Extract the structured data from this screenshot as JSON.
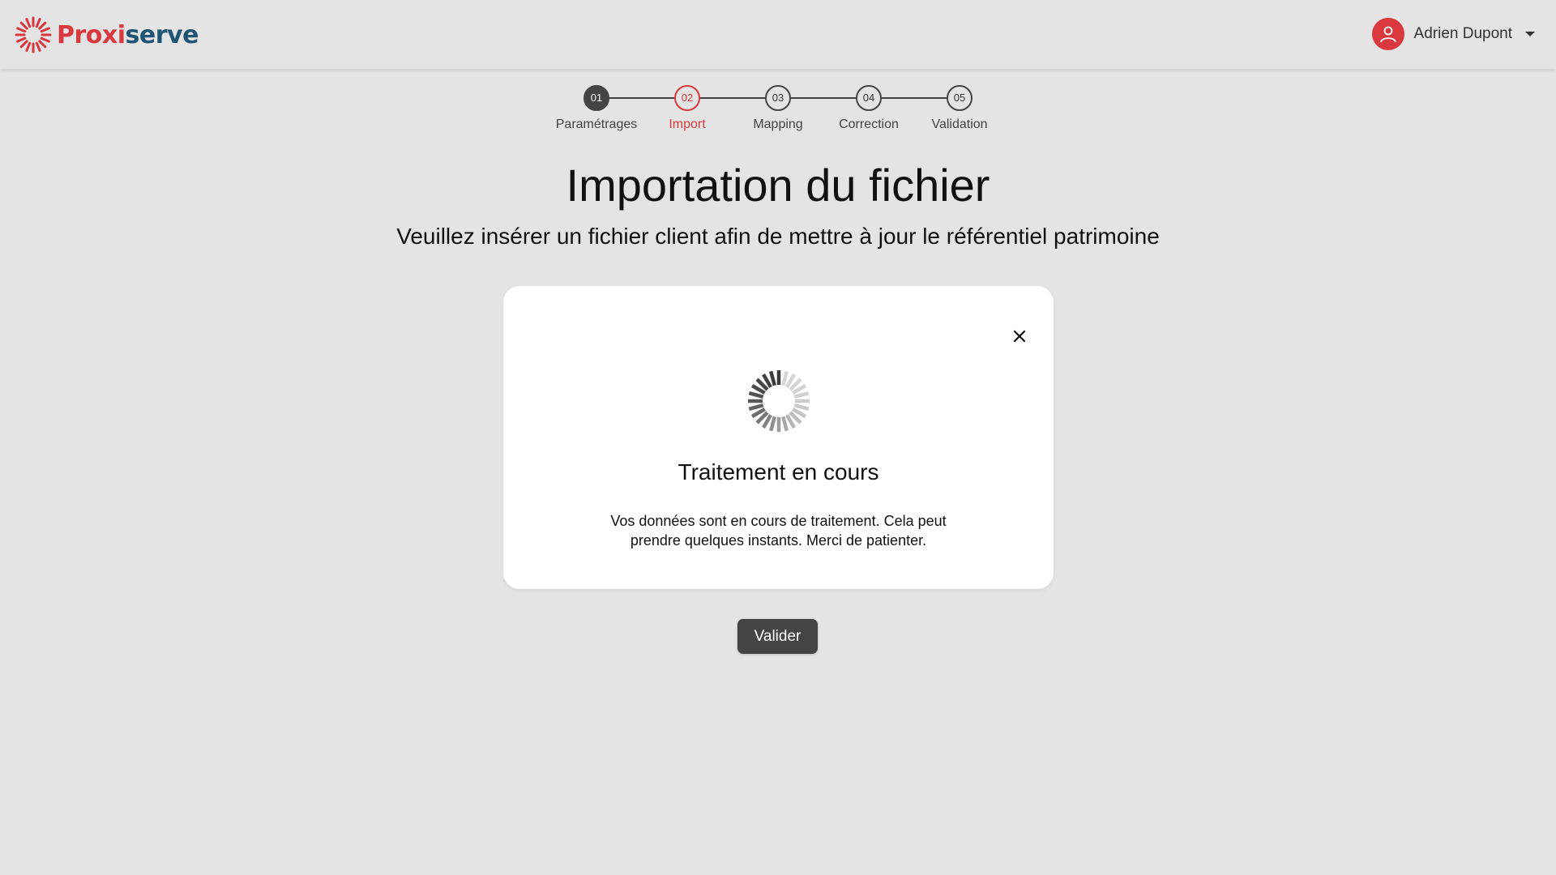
{
  "header": {
    "logo": {
      "part1": "Proxi",
      "part2": "serve"
    },
    "user": {
      "name": "Adrien Dupont",
      "avatar_icon": "user-icon"
    }
  },
  "stepper": {
    "current_step": 2,
    "steps": [
      {
        "number": "01",
        "label": "Paramétrages",
        "state": "done"
      },
      {
        "number": "02",
        "label": "Import",
        "state": "active"
      },
      {
        "number": "03",
        "label": "Mapping",
        "state": "pending"
      },
      {
        "number": "04",
        "label": "Correction",
        "state": "pending"
      },
      {
        "number": "05",
        "label": "Validation",
        "state": "pending"
      }
    ]
  },
  "page": {
    "title": "Importation du fichier",
    "subtitle": "Veuillez insérer un fichier client afin de mettre à jour le référentiel patrimoine"
  },
  "processing_card": {
    "close_icon": "close-icon",
    "spinner_icon": "loading-spinner-icon",
    "title": "Traitement en cours",
    "message": "Vos données sont en cours de traitement. Cela peut prendre quelques instants. Merci de patienter."
  },
  "actions": {
    "submit_label": "Valider"
  },
  "colors": {
    "brand_red": "#d9383f",
    "brand_blue": "#1f5573",
    "dark": "#444444",
    "background": "#e4e4e4"
  }
}
